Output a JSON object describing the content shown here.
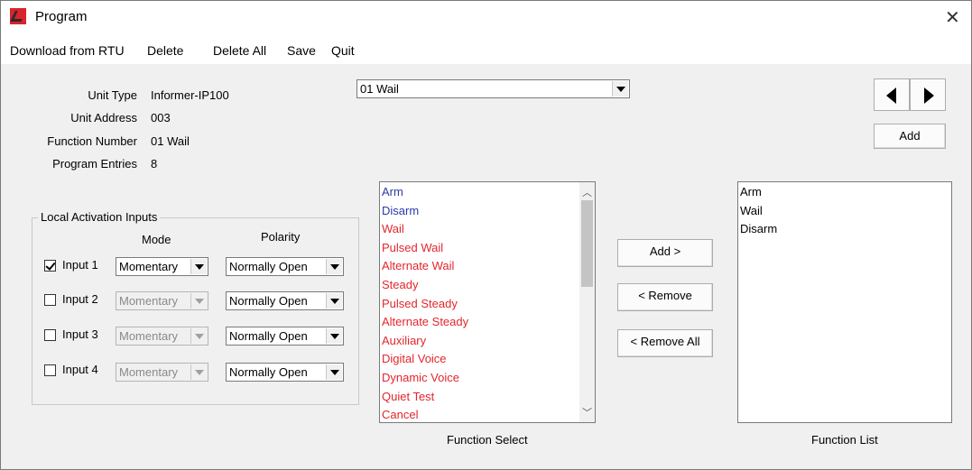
{
  "window": {
    "title": "Program",
    "close_glyph": "✕"
  },
  "menu": [
    "Download from RTU",
    "Delete",
    "Delete All",
    "Save",
    "Quit"
  ],
  "info": {
    "unit_type_label": "Unit Type",
    "unit_type_value": "Informer-IP100",
    "unit_address_label": "Unit Address",
    "unit_address_value": "003",
    "function_number_label": "Function Number",
    "function_number_value": "01 Wail",
    "program_entries_label": "Program Entries",
    "program_entries_value": "8"
  },
  "function_combo": {
    "value": "01 Wail"
  },
  "nav": {
    "add_label": "Add"
  },
  "local_inputs": {
    "title": "Local Activation Inputs",
    "mode_header": "Mode",
    "polarity_header": "Polarity",
    "rows": [
      {
        "label": "Input 1",
        "checked": true,
        "mode": "Momentary",
        "polarity": "Normally Open"
      },
      {
        "label": "Input 2",
        "checked": false,
        "mode": "Momentary",
        "polarity": "Normally Open"
      },
      {
        "label": "Input 3",
        "checked": false,
        "mode": "Momentary",
        "polarity": "Normally Open"
      },
      {
        "label": "Input 4",
        "checked": false,
        "mode": "Momentary",
        "polarity": "Normally Open"
      }
    ]
  },
  "function_select": {
    "caption": "Function Select",
    "items": [
      {
        "text": "Arm",
        "color": "#2b3aa8"
      },
      {
        "text": "Disarm",
        "color": "#2b3aa8"
      },
      {
        "text": "Wail",
        "color": "#e3262d"
      },
      {
        "text": "Pulsed Wail",
        "color": "#e3262d"
      },
      {
        "text": "Alternate Wail",
        "color": "#e3262d"
      },
      {
        "text": "Steady",
        "color": "#e3262d"
      },
      {
        "text": "Pulsed Steady",
        "color": "#e3262d"
      },
      {
        "text": "Alternate Steady",
        "color": "#e3262d"
      },
      {
        "text": "Auxiliary",
        "color": "#e3262d"
      },
      {
        "text": "Digital Voice",
        "color": "#e3262d"
      },
      {
        "text": "Dynamic Voice",
        "color": "#e3262d"
      },
      {
        "text": "Quiet Test",
        "color": "#e3262d"
      },
      {
        "text": "Cancel",
        "color": "#e3262d"
      }
    ]
  },
  "buttons": {
    "add": "Add >",
    "remove": "< Remove",
    "remove_all": "< Remove All"
  },
  "function_list": {
    "caption": "Function List",
    "items": [
      "Arm",
      "Wail",
      "Disarm"
    ]
  }
}
